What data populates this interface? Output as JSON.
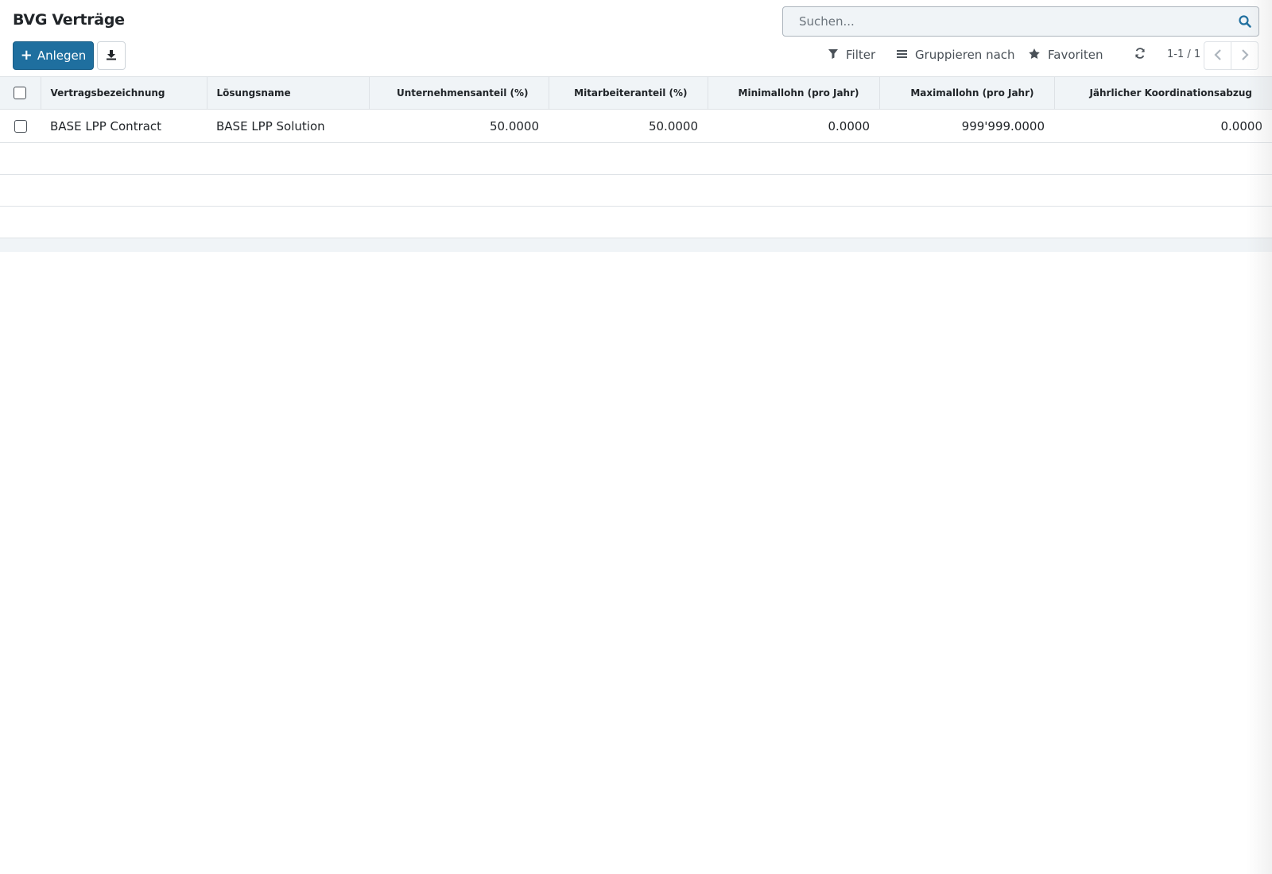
{
  "header": {
    "title": "BVG Verträge"
  },
  "search": {
    "placeholder": "Suchen...",
    "icon": "search-icon"
  },
  "actions": {
    "create_label": "Anlegen",
    "download_icon": "download-icon"
  },
  "toolbar": {
    "filter_label": "Filter",
    "group_by_label": "Gruppieren nach",
    "favorites_label": "Favoriten",
    "pager_text": "1-1 / 1"
  },
  "colors": {
    "primary": "#1f6f9f",
    "header_bg": "#f0f4f7",
    "border": "#dee2e6"
  },
  "table": {
    "columns": [
      "Vertragsbezeichnung",
      "Lösungsname",
      "Unternehmensanteil (%)",
      "Mitarbeiteranteil (%)",
      "Minimallohn (pro Jahr)",
      "Maximallohn (pro Jahr)",
      "Jährlicher Koordinationsabzug"
    ],
    "rows": [
      {
        "name": "BASE LPP Contract",
        "solution": "BASE LPP Solution",
        "company_share": "50.0000",
        "employee_share": "50.0000",
        "min_wage": "0.0000",
        "max_wage": "999'999.0000",
        "coordination_deduction": "0.0000"
      }
    ]
  }
}
